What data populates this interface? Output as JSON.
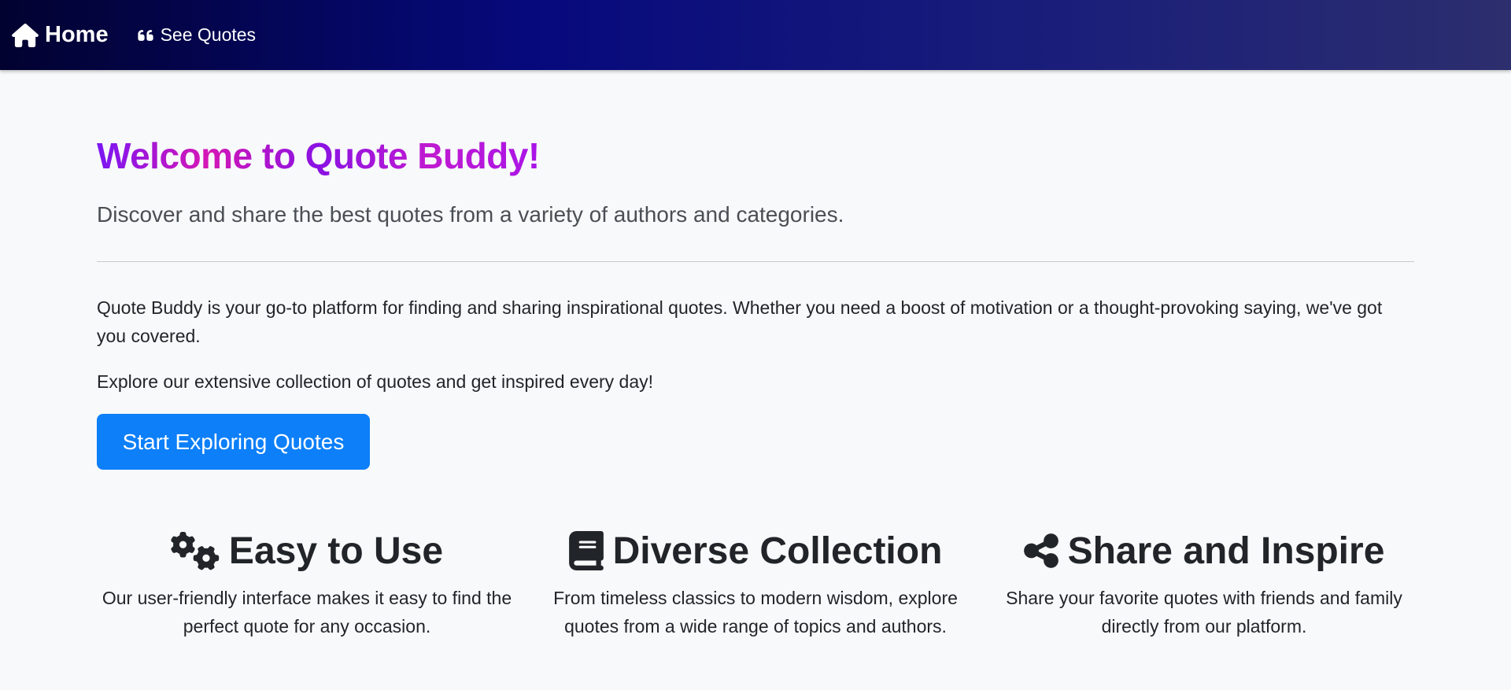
{
  "nav": {
    "home_label": "Home",
    "home_icon": "home-icon",
    "quotes_label": "See Quotes",
    "quotes_icon": "quote-left-icon"
  },
  "hero": {
    "title": "Welcome to Quote Buddy!",
    "lead": "Discover and share the best quotes from a variety of authors and categories.",
    "paragraph1": "Quote Buddy is your go-to platform for finding and sharing inspirational quotes. Whether you need a boost of motivation or a thought-provoking saying, we've got you covered.",
    "paragraph2": "Explore our extensive collection of quotes and get inspired every day!",
    "cta_label": "Start Exploring Quotes"
  },
  "features": [
    {
      "icon": "cogs-icon",
      "title": "Easy to Use",
      "text": "Our user-friendly interface makes it easy to find the perfect quote for any occasion."
    },
    {
      "icon": "book-icon",
      "title": "Diverse Collection",
      "text": "From timeless classics to modern wisdom, explore quotes from a wide range of topics and authors."
    },
    {
      "icon": "share-icon",
      "title": "Share and Inspire",
      "text": "Share your favorite quotes with friends and family directly from our platform."
    }
  ],
  "colors": {
    "primary_button": "#0d7ff8",
    "navbar_start": "#020230",
    "navbar_end": "#2c2e6e",
    "title_gradient": [
      "#7b16f2",
      "#d417b6"
    ]
  }
}
